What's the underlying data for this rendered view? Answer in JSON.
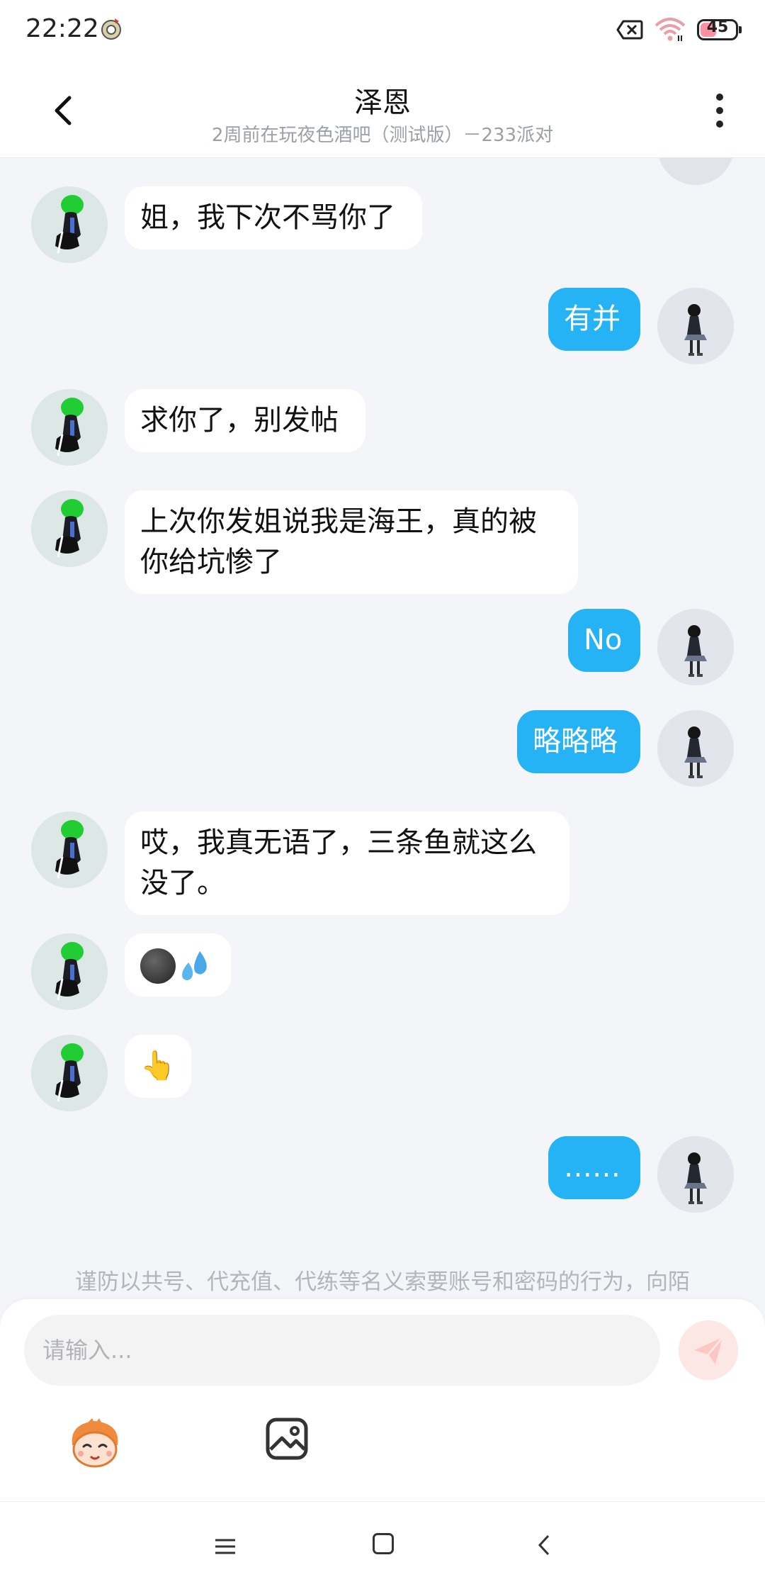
{
  "status_bar": {
    "time": "22:22",
    "battery": "45",
    "battery_level": 0.45
  },
  "header": {
    "title": "泽恩",
    "subtitle": "2周前在玩夜色酒吧（测试版）－233派对"
  },
  "messages": [
    {
      "side": "in",
      "text": "姐，我下次不骂你了"
    },
    {
      "side": "out",
      "text": "有并"
    },
    {
      "side": "in",
      "text": "求你了，别发帖"
    },
    {
      "side": "in",
      "text": "上次你发姐说我是海王，真的被你给坑惨了"
    },
    {
      "side": "out",
      "text": "No"
    },
    {
      "side": "out",
      "text": "略略略"
    },
    {
      "side": "in",
      "text": "哎，我真无语了，三条鱼就这么没了。"
    },
    {
      "side": "in",
      "emoji": [
        "dark-face-emoji",
        "sweat-droplets-emoji"
      ]
    },
    {
      "side": "in",
      "text": "👆"
    },
    {
      "side": "out",
      "text": "……"
    }
  ],
  "notice": "谨防以共号、代充值、代练等名义索要账号和密码的行为，向陌",
  "input": {
    "placeholder": "请输入..."
  },
  "icons": {
    "back": "back-arrow-icon",
    "more": "more-vertical-icon",
    "send": "send-paper-plane-icon",
    "mascot": "mascot-emoji-icon",
    "image": "image-picker-icon"
  },
  "colors": {
    "outgoing_bubble": "#25b3f5",
    "incoming_bubble": "#ffffff",
    "background": "#f3f5f9"
  }
}
